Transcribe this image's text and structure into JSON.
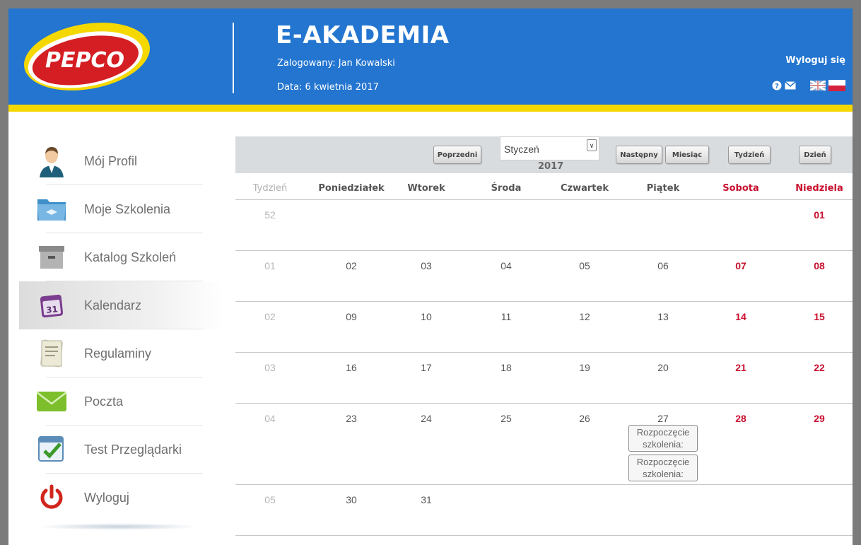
{
  "header": {
    "logo_text": "PEPCO",
    "title": "E-AKADEMIA",
    "logged_in": "Zalogowany: Jan Kowalski",
    "date": "Data: 6 kwietnia 2017",
    "logout": "Wyloguj się",
    "icons": [
      "help-icon",
      "mail-icon",
      "flag-uk-icon",
      "flag-pl-icon"
    ]
  },
  "sidebar": {
    "items": [
      {
        "label": "Mój Profil",
        "icon": "profile-icon"
      },
      {
        "label": "Moje Szkolenia",
        "icon": "folder-icon"
      },
      {
        "label": "Katalog Szkoleń",
        "icon": "archive-icon"
      },
      {
        "label": "Kalendarz",
        "icon": "calendar-icon",
        "active": true
      },
      {
        "label": "Regulaminy",
        "icon": "document-icon"
      },
      {
        "label": "Poczta",
        "icon": "envelope-icon"
      },
      {
        "label": "Test Przeglądarki",
        "icon": "browser-check-icon"
      },
      {
        "label": "Wyloguj",
        "icon": "power-icon"
      }
    ]
  },
  "calendar": {
    "toolbar": {
      "prev": "Poprzedni",
      "month": "Styczeń",
      "year": "2017",
      "next": "Następny",
      "month_view": "Miesiąc",
      "week_view": "Tydzień",
      "day_view": "Dzień"
    },
    "headers": [
      "Tydzień",
      "Poniedziałek",
      "Wtorek",
      "Środa",
      "Czwartek",
      "Piątek",
      "Sobota",
      "Niedziela"
    ],
    "weeks": [
      {
        "week": "52",
        "days": [
          "",
          "",
          "",
          "",
          "",
          "",
          "01"
        ]
      },
      {
        "week": "01",
        "days": [
          "02",
          "03",
          "04",
          "05",
          "06",
          "07",
          "08"
        ]
      },
      {
        "week": "02",
        "days": [
          "09",
          "10",
          "11",
          "12",
          "13",
          "14",
          "15"
        ]
      },
      {
        "week": "03",
        "days": [
          "16",
          "17",
          "18",
          "19",
          "20",
          "21",
          "22"
        ]
      },
      {
        "week": "04",
        "days": [
          "23",
          "24",
          "25",
          "26",
          "27",
          "28",
          "29"
        ]
      },
      {
        "week": "05",
        "days": [
          "30",
          "31",
          "",
          "",
          "",
          "",
          ""
        ]
      }
    ],
    "events": [
      {
        "week": 4,
        "day": 4,
        "text": "Rozpoczęcie szkolenia:"
      },
      {
        "week": 4,
        "day": 4,
        "text": "Rozpoczęcie szkolenia:"
      }
    ],
    "colors": {
      "weekend": "#c8102e",
      "header": "#2375d0",
      "stripe": "#f4d800"
    }
  }
}
